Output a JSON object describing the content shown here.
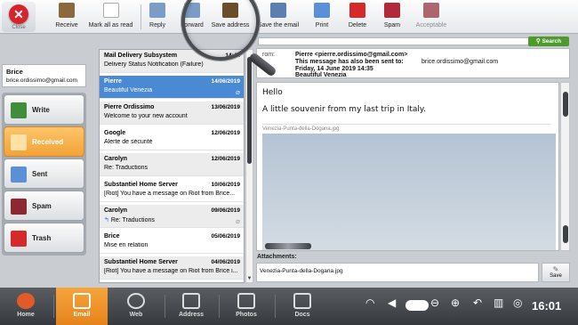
{
  "toolbar": {
    "close_label": "Close",
    "buttons": [
      {
        "label": "Receive",
        "icon": "receive-icon"
      },
      {
        "label": "Mark all as read",
        "icon": "mark-all-read-icon"
      },
      {
        "label": "Reply",
        "icon": "reply-icon"
      },
      {
        "label": "Forward",
        "icon": "forward-icon"
      },
      {
        "label": "Save address",
        "icon": "save-address-icon"
      },
      {
        "label": "Save the email",
        "icon": "save-email-icon"
      },
      {
        "label": "Print",
        "icon": "printer-icon"
      },
      {
        "label": "Delete",
        "icon": "delete-icon"
      },
      {
        "label": "Spam",
        "icon": "spam-icon"
      },
      {
        "label": "Acceptable",
        "icon": "acceptable-icon",
        "disabled": true
      }
    ]
  },
  "search": {
    "button_label": "Search",
    "placeholder": ""
  },
  "account": {
    "name": "Brice",
    "email": "brice.ordissimo@gmail.com"
  },
  "nav": [
    {
      "label": "Write",
      "icon": "write-icon"
    },
    {
      "label": "Received",
      "icon": "inbox-icon",
      "active": true
    },
    {
      "label": "Sent",
      "icon": "sent-icon"
    },
    {
      "label": "Spam",
      "icon": "spam-folder-icon"
    },
    {
      "label": "Trash",
      "icon": "trash-icon"
    }
  ],
  "messages": [
    {
      "sender": "Mail Delivery Subsystem",
      "date": "14:41",
      "subject": "Delivery Status Notification (Failure)"
    },
    {
      "sender": "Pierre",
      "date": "14/06/2019",
      "subject": "Beautiful Venezia",
      "selected": true,
      "attachment": true
    },
    {
      "sender": "Pierre Ordissimo",
      "date": "13/06/2019",
      "subject": "Welcome to your new account"
    },
    {
      "sender": "Google",
      "date": "12/06/2019",
      "subject": "Alerte de sécurité"
    },
    {
      "sender": "Carolyn",
      "date": "12/06/2019",
      "subject": "Re: Traductions"
    },
    {
      "sender": "Substantiel Home Server",
      "date": "10/06/2019",
      "subject": "[Riot] You have a message on Riot from Brice..."
    },
    {
      "sender": "Carolyn",
      "date": "09/06/2019",
      "subject": "Re: Traductions",
      "attachment": true,
      "replied": true
    },
    {
      "sender": "Brice",
      "date": "05/06/2019",
      "subject": "Mise en relation"
    },
    {
      "sender": "Substantiel Home Server",
      "date": "04/06/2019",
      "subject": "[Riot] You have a message on Riot from Brice i..."
    }
  ],
  "email": {
    "from_label": "rom:",
    "from": "Pierre <pierre.ordissimo@gmail.com>",
    "also_sent_label": "This message has also been sent to:",
    "also_sent_to": "brice.ordissimo@gmail.com",
    "date": "Friday, 14 June 2019 14:35",
    "subject": "Beautiful Venezia",
    "greeting": "Hello",
    "body": "A little souvenir from my last trip in Italy.",
    "image_caption": "Venezia-Punta-della-Dogana.jpg"
  },
  "attachments": {
    "label": "Attachments:",
    "files": [
      "Venezia-Punta-della-Dogana.jpg"
    ],
    "save_label": "Save"
  },
  "taskbar": {
    "apps": [
      {
        "label": "Home",
        "icon": "home-icon"
      },
      {
        "label": "Email",
        "icon": "email-icon",
        "active": true
      },
      {
        "label": "Web",
        "icon": "web-icon"
      },
      {
        "label": "Address",
        "icon": "address-icon"
      },
      {
        "label": "Photos",
        "icon": "photos-icon"
      },
      {
        "label": "Docs",
        "icon": "docs-icon"
      }
    ],
    "time": "16:01"
  },
  "colors": {
    "accent": "#f3a238",
    "selection": "#4a89d4",
    "search": "#4e9a2c",
    "close": "#d9232a"
  }
}
